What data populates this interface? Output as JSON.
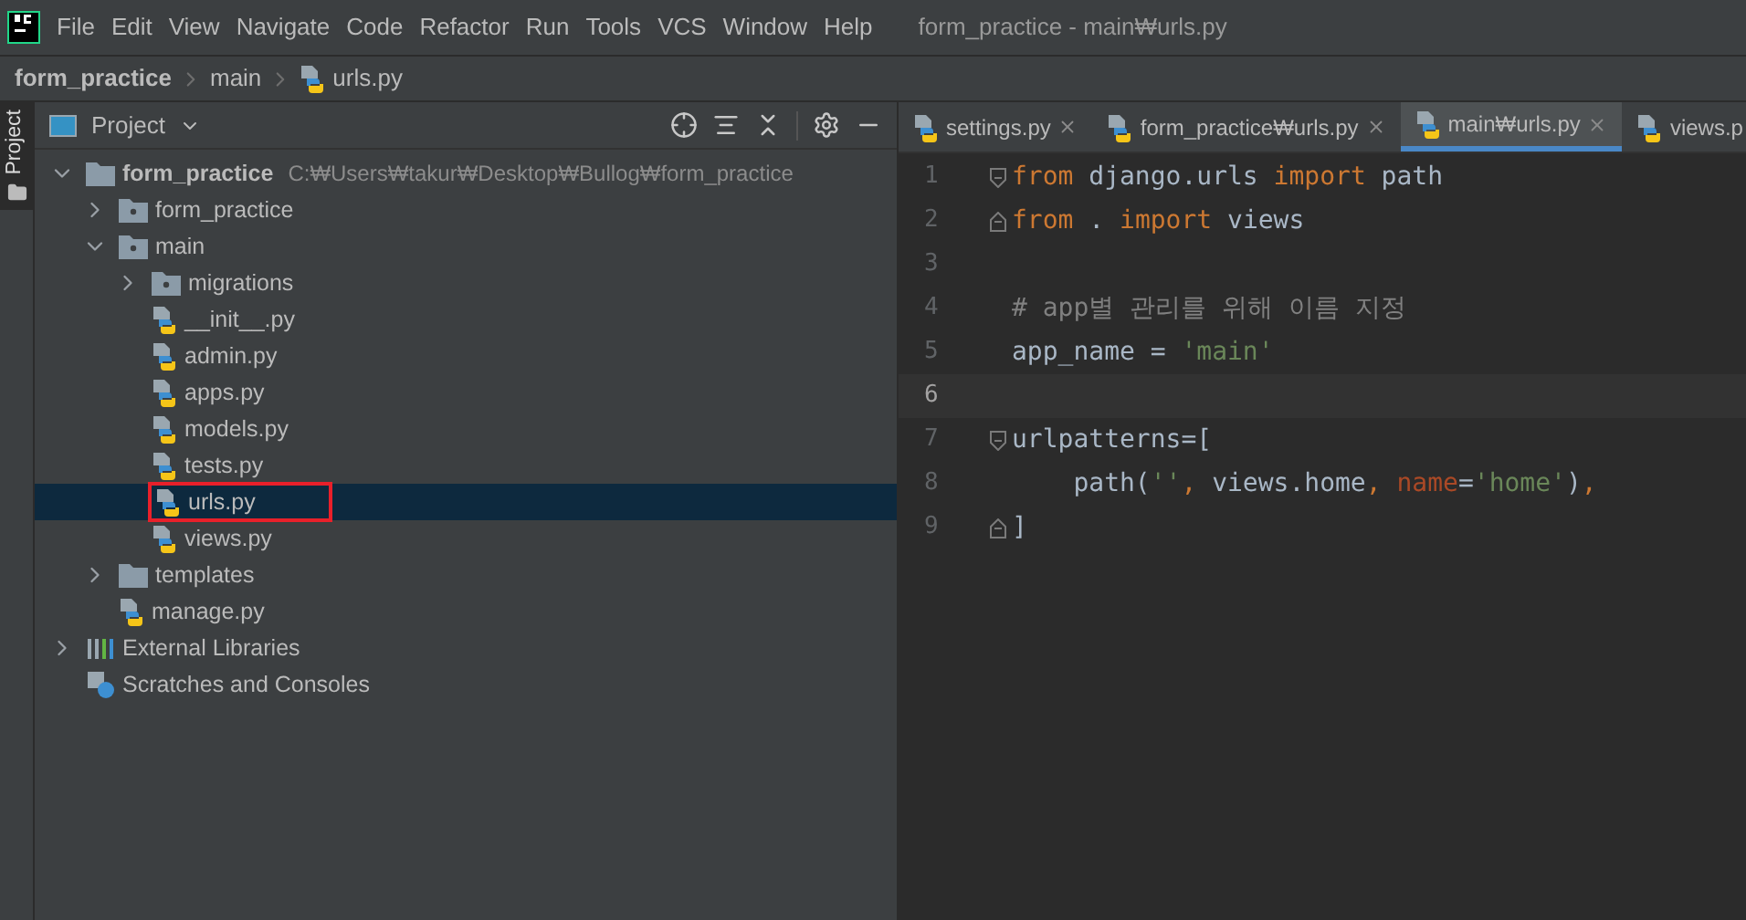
{
  "menu": [
    "File",
    "Edit",
    "View",
    "Navigate",
    "Code",
    "Refactor",
    "Run",
    "Tools",
    "VCS",
    "Window",
    "Help"
  ],
  "window": {
    "title": "form_practice - main₩urls.py"
  },
  "breadcrumb": [
    "form_practice",
    "main",
    "urls.py"
  ],
  "side_strip": {
    "label": "Project"
  },
  "project_panel": {
    "title": "Project"
  },
  "tree": [
    {
      "kind": "folder",
      "label": "form_practice",
      "path": "C:₩Users₩takur₩Desktop₩Bullog₩form_practice",
      "expanded": true,
      "children": [
        {
          "kind": "package",
          "label": "form_practice",
          "expanded": false
        },
        {
          "kind": "package",
          "label": "main",
          "expanded": true,
          "children": [
            {
              "kind": "package",
              "label": "migrations",
              "expanded": false
            },
            {
              "kind": "file",
              "label": "__init__.py",
              "selected": false,
              "highlighted": false
            },
            {
              "kind": "file",
              "label": "admin.py",
              "selected": false,
              "highlighted": false
            },
            {
              "kind": "file",
              "label": "apps.py",
              "selected": false,
              "highlighted": false
            },
            {
              "kind": "file",
              "label": "models.py",
              "selected": false,
              "highlighted": false
            },
            {
              "kind": "file",
              "label": "tests.py",
              "selected": false,
              "highlighted": false
            },
            {
              "kind": "file",
              "label": "urls.py",
              "selected": true,
              "highlighted": true
            },
            {
              "kind": "file",
              "label": "views.py",
              "selected": false,
              "highlighted": false
            }
          ]
        },
        {
          "kind": "folder",
          "label": "templates",
          "expanded": false
        },
        {
          "kind": "file",
          "label": "manage.py",
          "selected": false,
          "highlighted": false
        }
      ]
    },
    {
      "kind": "libraries",
      "label": "External Libraries",
      "expanded": false
    },
    {
      "kind": "scratches",
      "label": "Scratches and Consoles"
    }
  ],
  "tabs": [
    {
      "label": "settings.py",
      "selected": false
    },
    {
      "label": "form_practice₩urls.py",
      "selected": false
    },
    {
      "label": "main₩urls.py",
      "selected": true
    },
    {
      "label": "views.p",
      "selected": false
    }
  ],
  "code": [
    {
      "number": "1",
      "current": false,
      "fold_start": true,
      "tokens": [
        {
          "kind": "keyword",
          "text": "from"
        },
        {
          "kind": "plain",
          "text": " django.urls "
        },
        {
          "kind": "keyword",
          "text": "import"
        },
        {
          "kind": "plain",
          "text": " path"
        }
      ]
    },
    {
      "number": "2",
      "current": false,
      "fold_end": true,
      "tokens": [
        {
          "kind": "keyword",
          "text": "from"
        },
        {
          "kind": "plain",
          "text": " . "
        },
        {
          "kind": "keyword",
          "text": "import"
        },
        {
          "kind": "plain",
          "text": " views"
        }
      ]
    },
    {
      "number": "3",
      "current": false
    },
    {
      "number": "4",
      "current": false,
      "tokens": [
        {
          "kind": "comment",
          "text": "# app별 관리를 위해 이름 지정"
        }
      ]
    },
    {
      "number": "5",
      "current": false,
      "tokens": [
        {
          "kind": "plain",
          "text": "app_name = "
        },
        {
          "kind": "string",
          "text": "'main'"
        }
      ]
    },
    {
      "number": "6",
      "current": true
    },
    {
      "number": "7",
      "current": false,
      "fold_start": true,
      "tokens": [
        {
          "kind": "plain",
          "text": "urlpatterns=["
        }
      ]
    },
    {
      "number": "8",
      "current": false,
      "tokens": [
        {
          "kind": "plain",
          "text": "    path("
        },
        {
          "kind": "string",
          "text": "''"
        },
        {
          "kind": "keyword",
          "text": ", "
        },
        {
          "kind": "plain",
          "text": "views.home"
        },
        {
          "kind": "keyword",
          "text": ", "
        },
        {
          "kind": "param",
          "text": "name"
        },
        {
          "kind": "plain",
          "text": "="
        },
        {
          "kind": "string",
          "text": "'home'"
        },
        {
          "kind": "plain",
          "text": ")"
        },
        {
          "kind": "keyword",
          "text": ","
        }
      ]
    },
    {
      "number": "9",
      "current": false,
      "fold_end": true,
      "tokens": [
        {
          "kind": "plain",
          "text": "]"
        }
      ]
    }
  ]
}
